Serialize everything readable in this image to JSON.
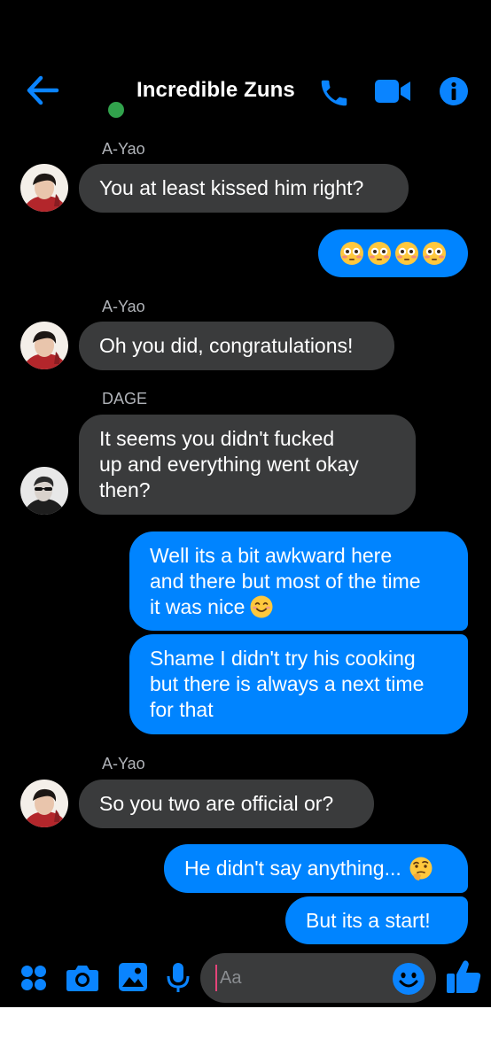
{
  "header": {
    "title": "Incredible Zuns"
  },
  "messages": [
    {
      "sender": "A-Yao",
      "text": "You at least kissed him right?"
    },
    {
      "text": "😳😳😳😳"
    },
    {
      "sender": "A-Yao",
      "text": "Oh you did, congratulations!"
    },
    {
      "sender": "DAGE",
      "lines": [
        "It seems you didn't fucked",
        "up and everything went okay",
        "then?"
      ]
    },
    {
      "lines": [
        "Well its a bit awkward here",
        "and there but most of the time",
        "it was nice"
      ]
    },
    {
      "lines": [
        "Shame I didn't try his cooking",
        "but there is always a next time",
        "for that"
      ]
    },
    {
      "sender": "A-Yao",
      "text": "So you two are official or?"
    },
    {
      "text": "He didn't say anything..."
    },
    {
      "text": "But its a start!"
    }
  ],
  "composer": {
    "placeholder": "Aa"
  },
  "colors": {
    "accent": "#0084ff",
    "incoming_bubble": "#3a3b3c",
    "online": "#31a24c"
  },
  "icons": [
    "back-arrow-icon",
    "phone-icon",
    "video-camera-icon",
    "info-icon",
    "apps-grid-icon",
    "camera-icon",
    "gallery-icon",
    "microphone-icon",
    "emoji-icon",
    "thumbs-up-icon",
    "flushed-emoji-icon",
    "smiling-emoji-icon",
    "thinking-emoji-icon"
  ]
}
